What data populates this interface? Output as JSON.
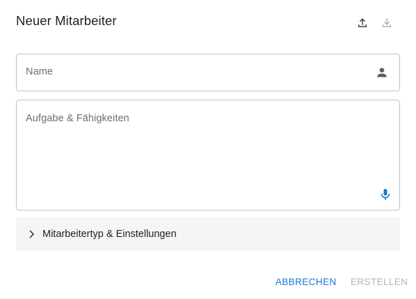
{
  "dialog": {
    "title": "Neuer Mitarbeiter"
  },
  "header_icons": [
    {
      "name": "upload-icon",
      "color": "#424242"
    },
    {
      "name": "download-icon",
      "color": "#b0b0b0"
    }
  ],
  "fields": {
    "name": {
      "label": "Name",
      "icon": "person-icon",
      "icon_color": "#5f5f5f"
    },
    "task": {
      "label": "Aufgabe & Fähigkeiten",
      "icon": "microphone-icon",
      "icon_color": "#1976d2"
    }
  },
  "expander": {
    "label": "Mitarbeitertyp & Einstellungen",
    "expanded": false
  },
  "actions": {
    "cancel_label": "ABBRECHEN",
    "create_label": "ERSTELLEN",
    "create_enabled": false
  },
  "colors": {
    "accent": "#1976d2",
    "disabled": "#b5b5b5",
    "border": "#c4c4c4"
  }
}
